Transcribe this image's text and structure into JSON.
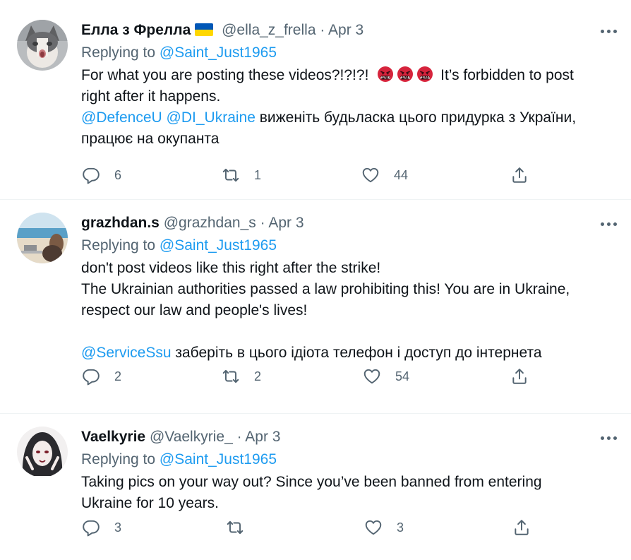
{
  "tweets": [
    {
      "name": "Елла з Фрелла",
      "handle": "@ella_z_frella",
      "sep": "·",
      "date": "Apr 3",
      "replying_prefix": "Replying to",
      "replying_to": "@Saint_Just1965",
      "line1_text": "For what you are posting these videos?!?!?!",
      "line1_after": "It’s forbidden to post",
      "line2_text": "right after it happens.",
      "mention1": "@DefenceU",
      "mention2": "@DI_Ukraine",
      "line3_after": "виженіть будьласка цього придурка з України,",
      "line4_text": "працює на окупанта",
      "emoji_icon": "face-with-symbols-on-mouth-icon",
      "stats": {
        "replies": "6",
        "retweets": "1",
        "likes": "44"
      }
    },
    {
      "name": "grazhdan.s",
      "handle": "@grazhdan_s",
      "sep": "·",
      "date": "Apr 3",
      "replying_prefix": "Replying to",
      "replying_to": "@Saint_Just1965",
      "line1_text": "don't post videos like this right after the strike!",
      "line2_text": "The Ukrainian authorities passed a law prohibiting this! You are in Ukraine,",
      "line3_text": "respect our law and people's lives!",
      "mention1": "@ServiceSsu",
      "line4_after": "заберіть в цього ідіота телефон і доступ до інтернета",
      "stats": {
        "replies": "2",
        "retweets": "2",
        "likes": "54"
      }
    },
    {
      "name": "Vaelkyrie",
      "handle": "@Vaelkyrie_",
      "sep": "·",
      "date": "Apr 3",
      "replying_prefix": "Replying to",
      "replying_to": "@Saint_Just1965",
      "line1_text": "Taking pics on your way out? Since you’ve been banned from entering",
      "line2_text": "Ukraine for 10 years.",
      "stats": {
        "replies": "3",
        "retweets": "",
        "likes": "3"
      }
    }
  ],
  "colors": {
    "text": "#0f1419",
    "muted": "#536471",
    "link": "#1d9bf0",
    "divider": "#eff3f4",
    "flag_blue": "#0057b7",
    "flag_yellow": "#ffd700"
  },
  "icons": [
    "reply-icon",
    "retweet-icon",
    "like-icon",
    "share-icon",
    "more-icon",
    "ukraine-flag-icon"
  ]
}
